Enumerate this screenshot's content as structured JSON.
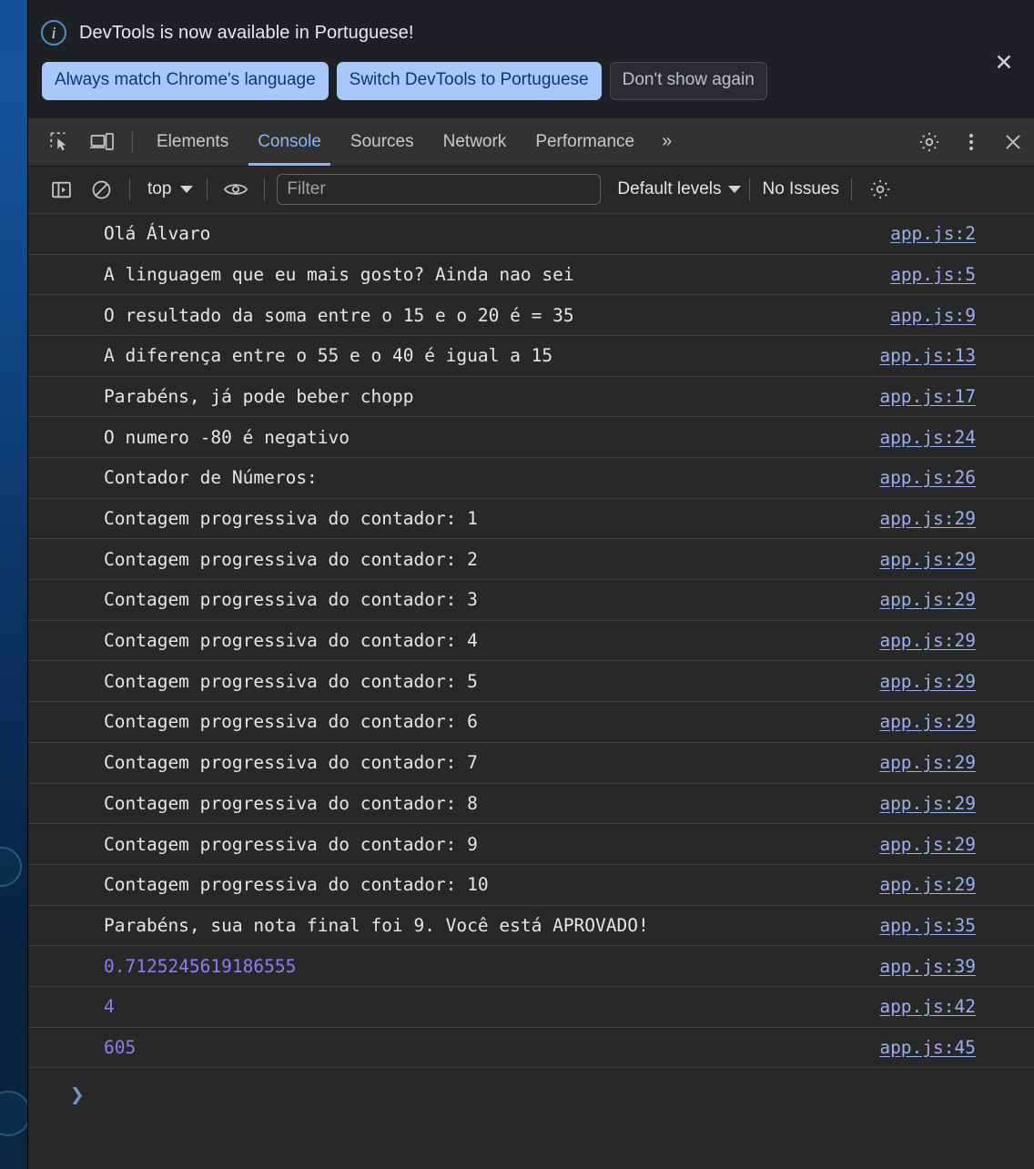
{
  "banner": {
    "icon": "info-circle-icon",
    "message": "DevTools is now available in Portuguese!",
    "primary_button": "Always match Chrome's language",
    "secondary_button": "Switch DevTools to Portuguese",
    "dismiss_button": "Don't show again",
    "close_icon": "✕"
  },
  "tabbar": {
    "inspect_icon": "inspect-element-icon",
    "device_icon": "device-toolbar-icon",
    "tabs": [
      {
        "label": "Elements",
        "active": false
      },
      {
        "label": "Console",
        "active": true
      },
      {
        "label": "Sources",
        "active": false
      },
      {
        "label": "Network",
        "active": false
      },
      {
        "label": "Performance",
        "active": false
      }
    ],
    "more_tabs": "»",
    "settings_icon": "gear-icon",
    "menu_icon": "three-dot-menu-icon",
    "close_icon": "✕"
  },
  "consolebar": {
    "sidebar_icon": "console-sidebar-icon",
    "clear_icon": "clear-console-icon",
    "context": "top",
    "eye_icon": "live-expression-eye-icon",
    "filter_value": "",
    "filter_placeholder": "Filter",
    "levels": "Default levels",
    "issues": "No Issues",
    "settings_icon": "gear-icon"
  },
  "console": {
    "prompt_caret": "❯",
    "messages": [
      {
        "text": "Olá Álvaro",
        "source": "app.js:2",
        "type": "log"
      },
      {
        "text": "A linguagem que eu mais gosto? Ainda nao sei",
        "source": "app.js:5",
        "type": "log"
      },
      {
        "text": "O resultado da soma entre o 15 e o 20 é = 35",
        "source": "app.js:9",
        "type": "log"
      },
      {
        "text": "A diferença entre o 55 e o 40 é igual a 15",
        "source": "app.js:13",
        "type": "log"
      },
      {
        "text": "Parabéns, já pode beber chopp",
        "source": "app.js:17",
        "type": "log"
      },
      {
        "text": "O numero -80 é negativo",
        "source": "app.js:24",
        "type": "log"
      },
      {
        "text": "Contador de Números:",
        "source": "app.js:26",
        "type": "log"
      },
      {
        "text": "Contagem progressiva do contador: 1",
        "source": "app.js:29",
        "type": "log"
      },
      {
        "text": "Contagem progressiva do contador: 2",
        "source": "app.js:29",
        "type": "log"
      },
      {
        "text": "Contagem progressiva do contador: 3",
        "source": "app.js:29",
        "type": "log"
      },
      {
        "text": "Contagem progressiva do contador: 4",
        "source": "app.js:29",
        "type": "log"
      },
      {
        "text": "Contagem progressiva do contador: 5",
        "source": "app.js:29",
        "type": "log"
      },
      {
        "text": "Contagem progressiva do contador: 6",
        "source": "app.js:29",
        "type": "log"
      },
      {
        "text": "Contagem progressiva do contador: 7",
        "source": "app.js:29",
        "type": "log"
      },
      {
        "text": "Contagem progressiva do contador: 8",
        "source": "app.js:29",
        "type": "log"
      },
      {
        "text": "Contagem progressiva do contador: 9",
        "source": "app.js:29",
        "type": "log"
      },
      {
        "text": "Contagem progressiva do contador: 10",
        "source": "app.js:29",
        "type": "log"
      },
      {
        "text": "Parabéns, sua nota final foi 9. Você está APROVADO!",
        "source": "app.js:35",
        "type": "log"
      },
      {
        "text": "0.7125245619186555",
        "source": "app.js:39",
        "type": "number"
      },
      {
        "text": "4",
        "source": "app.js:42",
        "type": "number"
      },
      {
        "text": "605",
        "source": "app.js:45",
        "type": "number"
      }
    ]
  },
  "colors": {
    "panel_bg": "#282828",
    "tabbar_bg": "#323232",
    "banner_bg": "#1f2023",
    "accent_blue": "#8ab4f8",
    "link_blue": "#9ab0ef",
    "number_violet": "#8f7bf5",
    "button_blue": "#a8c7fa",
    "button_blue_text": "#0b357e",
    "text": "#e6e6e6",
    "divider": "#3f3f3f"
  }
}
